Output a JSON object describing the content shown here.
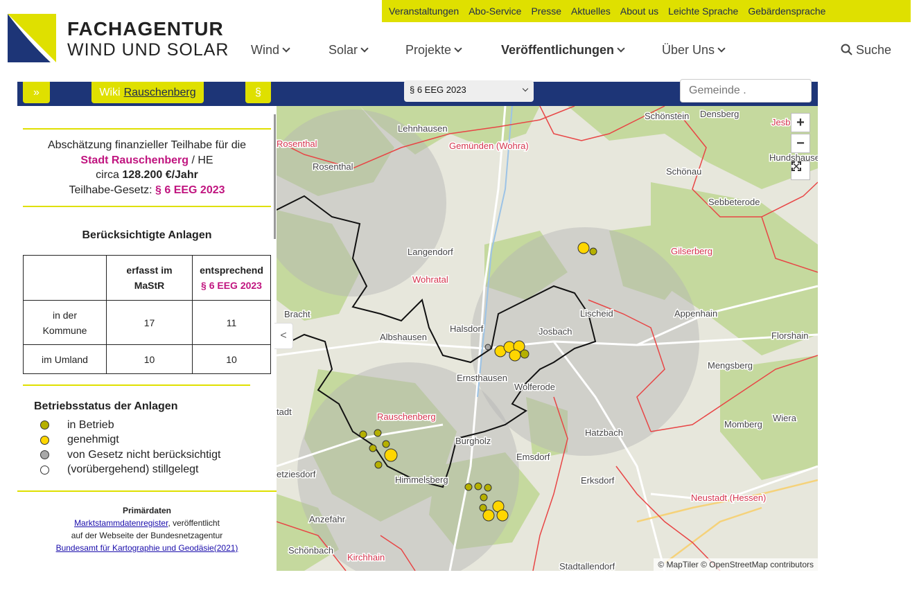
{
  "topnav": [
    "Veranstaltungen",
    "Abo-Service",
    "Presse",
    "Aktuelles",
    "About us",
    "Leichte Sprache",
    "Gebärdensprache"
  ],
  "logo": {
    "line1": "FACHAGENTUR",
    "line2": "WIND UND SOLAR"
  },
  "mainnav": [
    {
      "label": "Wind"
    },
    {
      "label": "Solar"
    },
    {
      "label": "Projekte"
    },
    {
      "label": "Veröffentlichungen"
    },
    {
      "label": "Über Uns"
    }
  ],
  "search_label": "Suche",
  "toolbar": {
    "expand_btn": "»",
    "wiki_prefix": "Wiki",
    "wiki_link": "Rauschenberg",
    "law_btn": "§",
    "law_select": "§ 6 EEG 2023",
    "gemeinde_placeholder": "Gemeinde ."
  },
  "summary": {
    "line1": "Abschätzung finanzieller Teilhabe für die",
    "municipality": "Stadt Rauschenberg",
    "state": " / HE",
    "circa": "circa ",
    "amount": "128.200 €/Jahr",
    "law_prefix": "Teilhabe-Gesetz: ",
    "law": "§ 6 EEG 2023"
  },
  "table": {
    "title": "Berücksichtigte Anlagen",
    "col1": "erfasst im MaStR",
    "col2_a": "entsprechend",
    "col2_b": "§ 6 EEG 2023",
    "rows": [
      {
        "label": "in der Kommune",
        "mastr": "17",
        "eeg": "11"
      },
      {
        "label": "im Umland",
        "mastr": "10",
        "eeg": "10"
      }
    ]
  },
  "legend": {
    "title": "Betriebsstatus der Anlagen",
    "items": [
      {
        "label": "in Betrieb",
        "color": "#b5b000"
      },
      {
        "label": "genehmigt",
        "color": "#ffd600"
      },
      {
        "label": "von Gesetz nicht berücksichtigt",
        "color": "#a8a8a8"
      },
      {
        "label": "(vorübergehend) stillgelegt",
        "color": "#ffffff"
      }
    ]
  },
  "primary": {
    "title": "Primärdaten",
    "link1": "Marktstammdatenregister",
    "text1": ", veröffentlicht",
    "text2": "auf der Webseite der Bundesnetzagentur",
    "link2": "Bundesamt für Kartographie und Geodäsie(2021)"
  },
  "map": {
    "zoom_in": "+",
    "zoom_out": "−",
    "collapse": "<",
    "attribution": "© MapTiler © OpenStreetMap contributors",
    "places": [
      {
        "name": "Lehnhausen",
        "red": false
      },
      {
        "name": "Gemünden (Wohra)",
        "red": true
      },
      {
        "name": "Schönstein",
        "red": false
      },
      {
        "name": "Densberg",
        "red": false
      },
      {
        "name": "Jesb",
        "red": true
      },
      {
        "name": "Rosenthal",
        "red": true
      },
      {
        "name": "Rosenthal",
        "red": false
      },
      {
        "name": "Schönau",
        "red": false
      },
      {
        "name": "Hundshause",
        "red": false
      },
      {
        "name": "Sebbeterode",
        "red": false
      },
      {
        "name": "Langendorf",
        "red": false
      },
      {
        "name": "Gilserberg",
        "red": true
      },
      {
        "name": "Wohratal",
        "red": true
      },
      {
        "name": "Lischeid",
        "red": false
      },
      {
        "name": "Appenhain",
        "red": false
      },
      {
        "name": "Bracht",
        "red": false
      },
      {
        "name": "Halsdorf",
        "red": false
      },
      {
        "name": "Josbach",
        "red": false
      },
      {
        "name": "Florshain",
        "red": false
      },
      {
        "name": "Albshausen",
        "red": false
      },
      {
        "name": "Mengsberg",
        "red": false
      },
      {
        "name": "Ernsthausen",
        "red": false
      },
      {
        "name": "Wolferode",
        "red": false
      },
      {
        "name": "tadt",
        "red": false
      },
      {
        "name": "Rauschenberg",
        "red": true
      },
      {
        "name": "Wiera",
        "red": false
      },
      {
        "name": "Momberg",
        "red": false
      },
      {
        "name": "Burgholz",
        "red": false
      },
      {
        "name": "Hatzbach",
        "red": false
      },
      {
        "name": "Emsdorf",
        "red": false
      },
      {
        "name": "etziesdorf",
        "red": false
      },
      {
        "name": "Himmelsberg",
        "red": false
      },
      {
        "name": "Erksdorf",
        "red": false
      },
      {
        "name": "Neustadt (Hessen)",
        "red": true
      },
      {
        "name": "Anzefahr",
        "red": false
      },
      {
        "name": "Schönbach",
        "red": false
      },
      {
        "name": "Kirchhain",
        "red": true
      },
      {
        "name": "Stadtallendorf",
        "red": false
      }
    ]
  }
}
